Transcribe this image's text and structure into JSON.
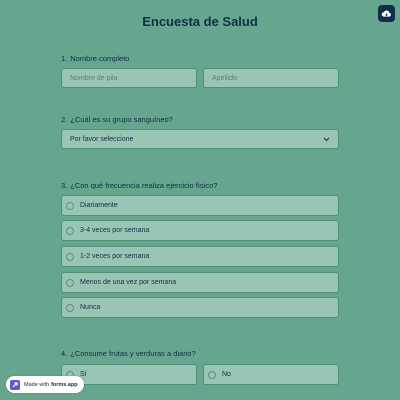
{
  "header": {
    "title": "Encuesta de Salud",
    "save_icon": "cloud-save-icon"
  },
  "questions": [
    {
      "number": "1.",
      "label": "Nombre completo",
      "first_name_placeholder": "Nombre de pila",
      "last_name_placeholder": "Apellido"
    },
    {
      "number": "2.",
      "label": "¿Cuál es su grupo sanguíneo?",
      "select_value": "Por favor seleccione"
    },
    {
      "number": "3.",
      "label": "¿Con qué frecuencia realiza ejercicio físico?",
      "options": [
        "Diariamente",
        "3-4 veces por semana",
        "1-2 veces por semana",
        "Menos de una vez por semana",
        "Nunca"
      ]
    },
    {
      "number": "4.",
      "label": "¿Consume frutas y verduras a diario?",
      "options": [
        "Sí",
        "No"
      ]
    }
  ],
  "badge": {
    "prefix": "Made with",
    "brand": "forms.app"
  },
  "colors": {
    "background": "#66a58e",
    "field": "#99c6b4",
    "text": "#0f2f46"
  }
}
